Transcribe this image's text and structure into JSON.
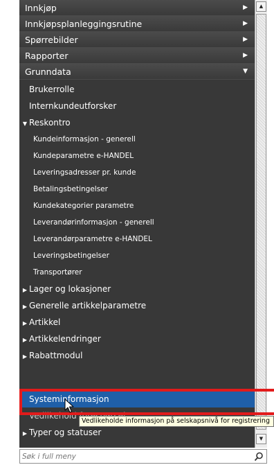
{
  "menu": {
    "top_items": [
      {
        "label": "Innkjøp",
        "arrow": "▶"
      },
      {
        "label": "Innkjøpsplanleggingsrutine",
        "arrow": "▶"
      },
      {
        "label": "Spørrebilder",
        "arrow": "▶"
      },
      {
        "label": "Rapporter",
        "arrow": "▶"
      },
      {
        "label": "Grunndata",
        "arrow": "▼"
      }
    ],
    "grunndata_items": [
      {
        "label": "Brukerrolle"
      },
      {
        "label": "Internkundeutforsker"
      }
    ],
    "reskontro": {
      "label": "Reskontro",
      "toggle": "▼",
      "children": [
        "Kundeinformasjon - generell",
        "Kundeparametre e-HANDEL",
        "Leveringsadresser pr. kunde",
        "Betalingsbetingelser",
        "Kundekategorier parametre",
        "Leverandørinformasjon - generell",
        "Leverandørparametre e-HANDEL",
        "Leveringsbetingelser",
        "Transportører"
      ]
    },
    "groups": [
      {
        "label": "Lager og lokasjoner",
        "toggle": "▶"
      },
      {
        "label": "Generelle artikkelparametre",
        "toggle": "▶"
      },
      {
        "label": "Artikkel",
        "toggle": "▶"
      },
      {
        "label": "Artikkelendringer",
        "toggle": "▶"
      },
      {
        "label": "Rabattmodul",
        "toggle": "▶"
      }
    ],
    "selected_item": "Systeminformasjon",
    "partial_item": "Vedlikehold forespørsel",
    "last_group": {
      "label": "Typer og statuser",
      "toggle": "▶"
    }
  },
  "tooltip": "Vedlikeholde informasjon på selskapsnivå for registrering",
  "search": {
    "placeholder": "Søk i full meny",
    "value": ""
  },
  "scrollbar": {
    "up_glyph": "▲",
    "down_glyph": "▼"
  },
  "colors": {
    "menu_bg": "#383838",
    "selected_bg": "#1f5fa8",
    "highlight_border": "#e21b1b",
    "tooltip_bg": "#ffffe1"
  }
}
